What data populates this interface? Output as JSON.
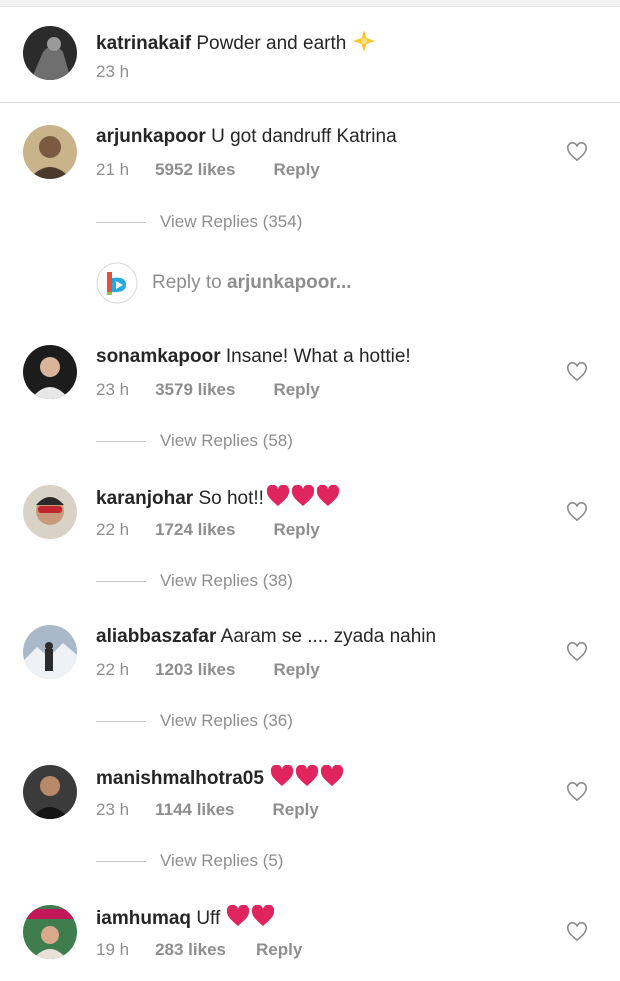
{
  "caption": {
    "username": "katrinakaif",
    "text": "Powder and earth",
    "time": "23 h"
  },
  "comments": [
    {
      "username": "arjunkapoor",
      "text": "U got dandruff Katrina",
      "time": "21 h",
      "likes": "5952 likes",
      "reply": "Reply",
      "view_replies": "View Replies (354)"
    },
    {
      "username": "sonamkapoor",
      "text": "Insane! What a hottie!",
      "time": "23 h",
      "likes": "3579 likes",
      "reply": "Reply",
      "view_replies": "View Replies (58)"
    },
    {
      "username": "karanjohar",
      "text": "So hot!!",
      "time": "22 h",
      "likes": "1724 likes",
      "reply": "Reply",
      "view_replies": "View Replies (38)"
    },
    {
      "username": "aliabbaszafar",
      "text": "Aaram se .... zyada nahin",
      "time": "22 h",
      "likes": "1203 likes",
      "reply": "Reply",
      "view_replies": "View Replies (36)"
    },
    {
      "username": "manishmalhotra05",
      "text": "",
      "time": "23 h",
      "likes": "1144 likes",
      "reply": "Reply",
      "view_replies": "View Replies (5)"
    },
    {
      "username": "iamhumaq",
      "text": "Uff",
      "time": "19 h",
      "likes": "283 likes",
      "reply": "Reply"
    }
  ],
  "reply_to": {
    "prefix": "Reply to",
    "username": "arjunkapoor..."
  },
  "icons": {
    "like": "heart-outline-icon",
    "emoji": "red-heart-emoji",
    "sparkle": "star-emoji"
  },
  "colors": {
    "heart": "#e0245e",
    "meta": "#8e8e8e",
    "text": "#262626"
  }
}
